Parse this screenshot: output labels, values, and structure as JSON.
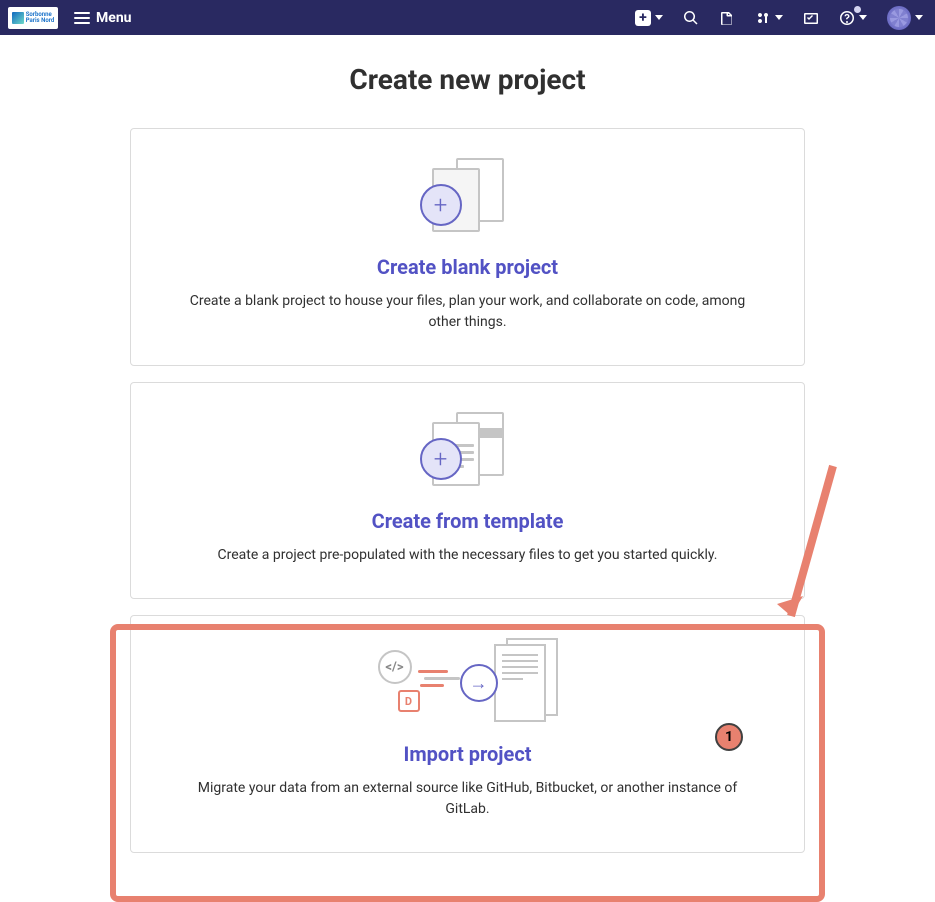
{
  "nav": {
    "menu_label": "Menu"
  },
  "page": {
    "title": "Create new project"
  },
  "cards": {
    "blank": {
      "title": "Create blank project",
      "desc": "Create a blank project to house your files, plan your work, and collaborate on code, among other things."
    },
    "template": {
      "title": "Create from template",
      "desc": "Create a project pre-populated with the necessary files to get you started quickly."
    },
    "import": {
      "title": "Import project",
      "desc": "Migrate your data from an external source like GitHub, Bitbucket, or another instance of GitLab."
    }
  },
  "annotation": {
    "badge": "1"
  }
}
